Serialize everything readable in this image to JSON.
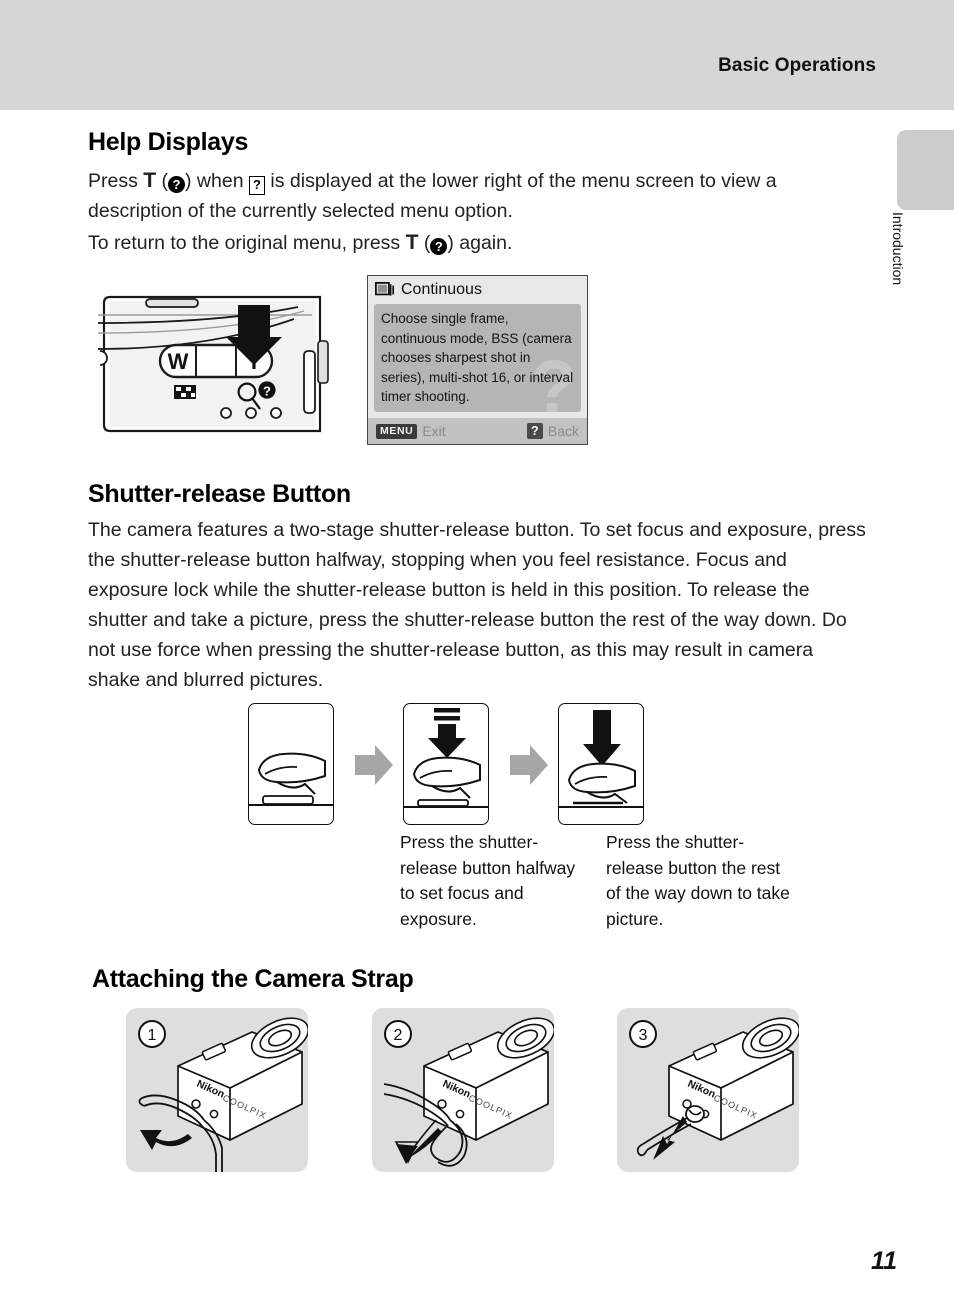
{
  "header": {
    "running_title": "Basic Operations"
  },
  "side_tab": {
    "label": "Introduction"
  },
  "sections": {
    "help_displays": {
      "heading": "Help Displays",
      "para1_a": "Press ",
      "para1_t": "T",
      "para1_b": " (",
      "para1_q1": "?",
      "para1_c": ") when ",
      "para1_q2": "?",
      "para1_d": " is displayed at the lower right of the menu screen to view a description of the currently selected menu option.",
      "para2_a": "To return to the original menu, press ",
      "para2_t": "T",
      "para2_b": " (",
      "para2_q": "?",
      "para2_c": ") again."
    },
    "shutter_release": {
      "heading": "Shutter-release Button",
      "body": "The camera features a two-stage shutter-release button. To set focus and exposure, press the shutter-release button halfway, stopping when you feel resistance. Focus and exposure lock while the shutter-release button is held in this position. To release the shutter and take a picture, press the shutter-release button the rest of the way down. Do not use force when pressing the shutter-release button, as this may result in camera shake and blurred pictures.",
      "caption_halfway": "Press the shutter-release button halfway to set focus and exposure.",
      "caption_full": "Press the shutter-release button the rest of the way down to take picture."
    },
    "camera_strap": {
      "heading": "Attaching the Camera Strap",
      "steps": [
        {
          "number": "1"
        },
        {
          "number": "2"
        },
        {
          "number": "3"
        }
      ]
    }
  },
  "zoom_control_figure": {
    "wide_label": "W",
    "tele_label": "T",
    "help_mark": "?"
  },
  "menu_screen": {
    "title": "Continuous",
    "description": "Choose single frame, continuous mode, BSS (camera chooses sharpest shot in series), multi-shot 16, or interval timer shooting.",
    "watermark": "?",
    "footer_left_badge": "MENU",
    "footer_left_label": "Exit",
    "footer_right_badge": "?",
    "footer_right_label": "Back"
  },
  "camera_brand": {
    "maker": "Nikon",
    "line": "COOLPIX"
  },
  "footer": {
    "page_number": "11"
  },
  "colors": {
    "header_band": "#d6d6d6",
    "side_tab": "#cccccc",
    "menu_body_gray": "#b5b5b5",
    "menu_footer_gray": "#c2c2c2",
    "panel_gray": "#dedede",
    "arrow_gray": "#a6a6a6",
    "ink": "#111111"
  }
}
